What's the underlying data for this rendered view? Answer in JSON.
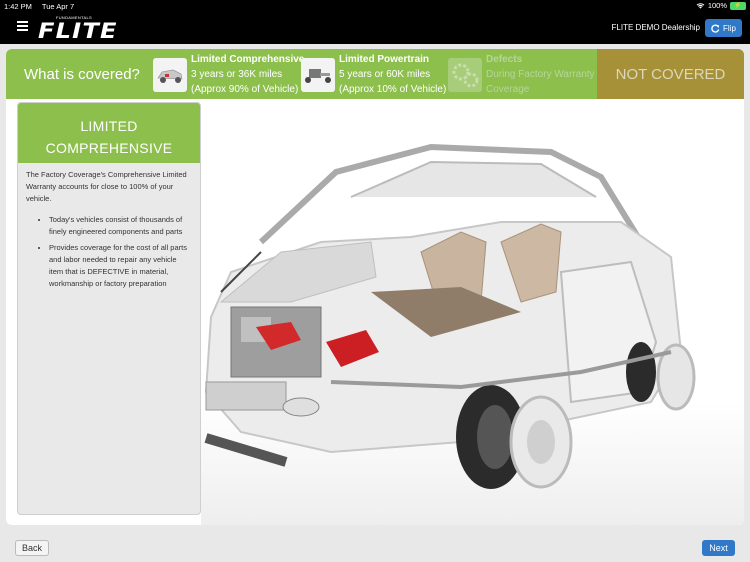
{
  "status": {
    "time": "1:42 PM",
    "date": "Tue Apr 7",
    "battery_pct": "100%",
    "battery_icon_text": "⚡"
  },
  "header": {
    "logo_tag": "FUNDAMENTALS",
    "logo_word": "FLITE",
    "dealership": "FLITE DEMO Dealership",
    "flip_label": "Flip"
  },
  "coverage": {
    "question": "What is covered?",
    "items": [
      {
        "title": "Limited Comprehensive",
        "line1": "3 years or 36K miles",
        "line2": "(Approx 90% of Vehicle)"
      },
      {
        "title": "Limited Powertrain",
        "line1": "5 years or 60K miles",
        "line2": "(Approx 10% of Vehicle)"
      },
      {
        "title": "Defects",
        "line1": "During Factory Warranty",
        "line2": "Coverage"
      }
    ],
    "not_covered": "NOT COVERED"
  },
  "panel": {
    "title_line1": "LIMITED",
    "title_line2": "COMPREHENSIVE",
    "intro": "The Factory Coverage's Comprehensive Limited Warranty accounts for close to 100% of your vehicle.",
    "bullets": [
      "Today's vehicles consist of thousands of finely engineered components and parts",
      "Provides coverage for the cost of all parts and labor needed to repair any vehicle item that is DEFECTIVE in material, workmanship or factory preparation"
    ]
  },
  "footer": {
    "back_label": "Back",
    "next_label": "Next"
  },
  "colors": {
    "accent_green": "#8dbf4d",
    "not_covered": "#a69138",
    "button_blue": "#2f79c8"
  }
}
